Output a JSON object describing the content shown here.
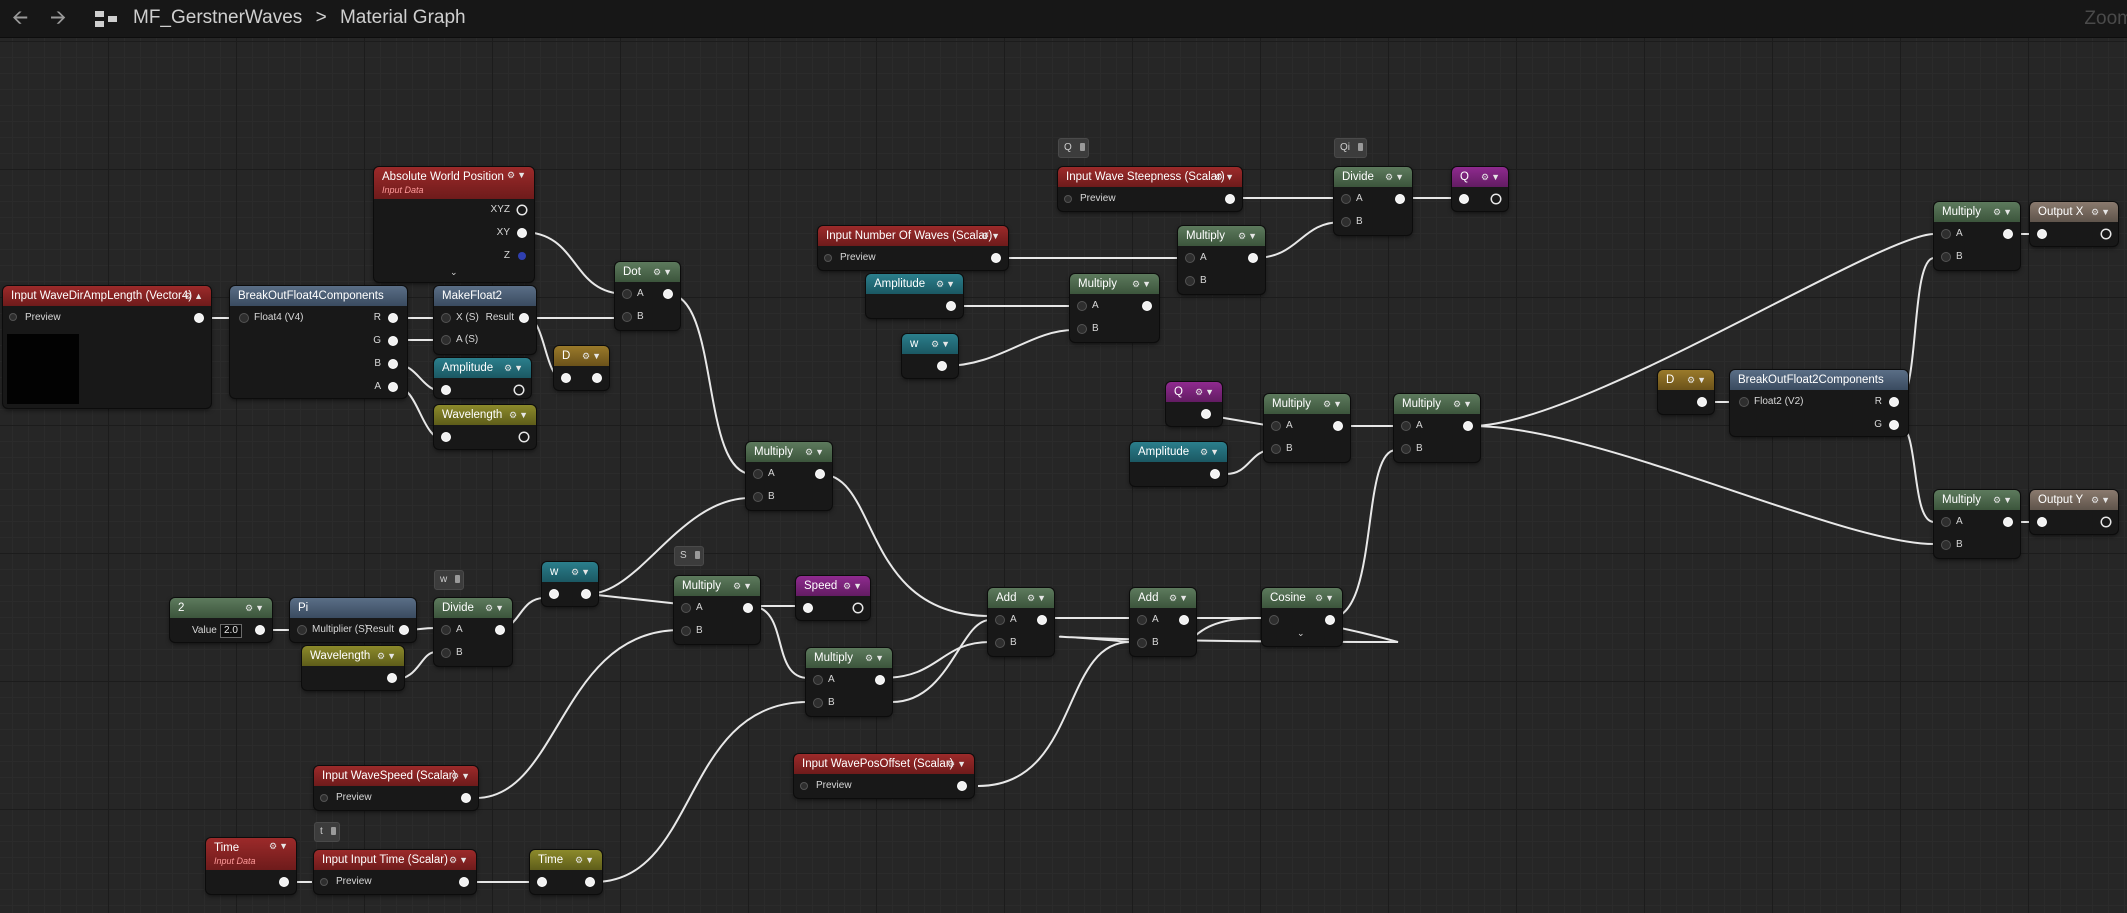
{
  "toolbar": {
    "back_icon": "arrow-left-icon",
    "forward_icon": "arrow-right-icon"
  },
  "breadcrumb": {
    "asset": "MF_GerstnerWaves",
    "separator": ">",
    "graph": "Material Graph"
  },
  "zoom_label": "Zoom",
  "nodes": {
    "abs_world_pos": {
      "title": "Absolute World Position",
      "subtitle": "Input Data",
      "pins": [
        "XYZ",
        "XY",
        "Z"
      ]
    },
    "wave_dir": {
      "title": "Input WaveDirAmpLength (Vector4)",
      "preview": "Preview"
    },
    "break4": {
      "title": "BreakOutFloat4Components",
      "input": "Float4 (V4)",
      "pins": [
        "R",
        "G",
        "B",
        "A"
      ]
    },
    "makefloat2": {
      "title": "MakeFloat2",
      "pin_x": "X (S)",
      "pin_y": "A (S)",
      "result": "Result"
    },
    "amp1": {
      "title": "Amplitude"
    },
    "wavelength1": {
      "title": "Wavelength"
    },
    "dot": {
      "title": "Dot",
      "a": "A",
      "b": "B"
    },
    "d1": {
      "title": "D"
    },
    "num_waves": {
      "title": "Input Number Of Waves (Scalar)",
      "preview": "Preview"
    },
    "amp2": {
      "title": "Amplitude"
    },
    "w1": {
      "title": "w"
    },
    "mult_a": {
      "title": "Multiply",
      "a": "A",
      "b": "B"
    },
    "mult_b": {
      "title": "Multiply",
      "a": "A",
      "b": "B"
    },
    "steepness": {
      "title": "Input Wave Steepness (Scalar)",
      "preview": "Preview"
    },
    "divide_qi": {
      "title": "Divide",
      "a": "A",
      "b": "B"
    },
    "q_out": {
      "title": "Q"
    },
    "reroute_q": {
      "title": "Q"
    },
    "reroute_qi": {
      "title": "Qi"
    },
    "q2": {
      "title": "Q"
    },
    "amp3": {
      "title": "Amplitude"
    },
    "mult_c": {
      "title": "Multiply",
      "a": "A",
      "b": "B"
    },
    "mult_d": {
      "title": "Multiply",
      "a": "A",
      "b": "B"
    },
    "mult_dot": {
      "title": "Multiply",
      "a": "A",
      "b": "B"
    },
    "const2": {
      "title": "2",
      "value_label": "Value",
      "value": "2.0"
    },
    "pi": {
      "title": "Pi",
      "input": "Multiplier (S)",
      "result": "Result"
    },
    "wavelength2": {
      "title": "Wavelength"
    },
    "divide_w": {
      "title": "Divide",
      "a": "A",
      "b": "B"
    },
    "reroute_w": {
      "title": "w"
    },
    "w2": {
      "title": "w"
    },
    "reroute_s": {
      "title": "S"
    },
    "mult_speed": {
      "title": "Multiply",
      "a": "A",
      "b": "B"
    },
    "speed": {
      "title": "Speed"
    },
    "mult_time": {
      "title": "Multiply",
      "a": "A",
      "b": "B"
    },
    "add1": {
      "title": "Add",
      "a": "A",
      "b": "B"
    },
    "add2": {
      "title": "Add",
      "a": "A",
      "b": "B"
    },
    "cosine": {
      "title": "Cosine"
    },
    "wave_speed": {
      "title": "Input WaveSpeed (Scalar)",
      "preview": "Preview"
    },
    "pos_offset": {
      "title": "Input WavePosOffset (Scalar)",
      "preview": "Preview"
    },
    "time": {
      "title": "Time",
      "subtitle": "Input Data"
    },
    "input_time": {
      "title": "Input Input Time (Scalar)",
      "preview": "Preview"
    },
    "reroute_t": {
      "title": "t"
    },
    "time_named": {
      "title": "Time"
    },
    "d2": {
      "title": "D"
    },
    "break2": {
      "title": "BreakOutFloat2Components",
      "input": "Float2 (V2)",
      "pins": [
        "R",
        "G"
      ]
    },
    "mult_x": {
      "title": "Multiply",
      "a": "A",
      "b": "B"
    },
    "mult_y": {
      "title": "Multiply",
      "a": "A",
      "b": "B"
    },
    "out_x": {
      "title": "Output X"
    },
    "out_y": {
      "title": "Output Y"
    }
  }
}
